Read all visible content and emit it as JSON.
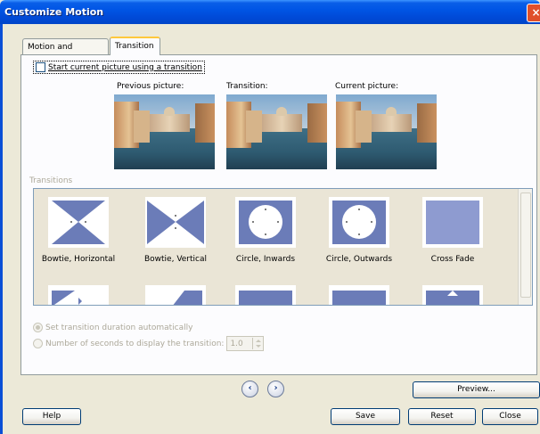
{
  "window": {
    "title": "Customize Motion",
    "close_glyph": "×"
  },
  "tabs": [
    {
      "label": "Motion and Duration",
      "active": false
    },
    {
      "label": "Transition",
      "active": true
    }
  ],
  "start_transition": {
    "label": "Start current picture using a transition",
    "checked": false
  },
  "previews": [
    {
      "label": "Previous picture:"
    },
    {
      "label": "Transition:"
    },
    {
      "label": "Current picture:"
    }
  ],
  "transitions": {
    "section_label": "Transitions",
    "items": [
      {
        "label": "Bowtie, Horizontal",
        "icon": "bowtie-horizontal-icon"
      },
      {
        "label": "Bowtie, Vertical",
        "icon": "bowtie-vertical-icon"
      },
      {
        "label": "Circle, Inwards",
        "icon": "circle-inwards-icon"
      },
      {
        "label": "Circle, Outwards",
        "icon": "circle-outwards-icon"
      },
      {
        "label": "Cross Fade",
        "icon": "cross-fade-icon"
      }
    ]
  },
  "duration": {
    "auto_label": "Set transition duration automatically",
    "manual_label": "Number of seconds to display the transition:",
    "seconds_value": "1.0"
  },
  "nav": {
    "prev_glyph": "‹",
    "next_glyph": "›"
  },
  "buttons": {
    "preview": "Preview...",
    "help": "Help",
    "save": "Save",
    "reset": "Reset",
    "close": "Close"
  },
  "colors": {
    "accent": "#6B7CB8",
    "title_bar": "#0055E5"
  }
}
